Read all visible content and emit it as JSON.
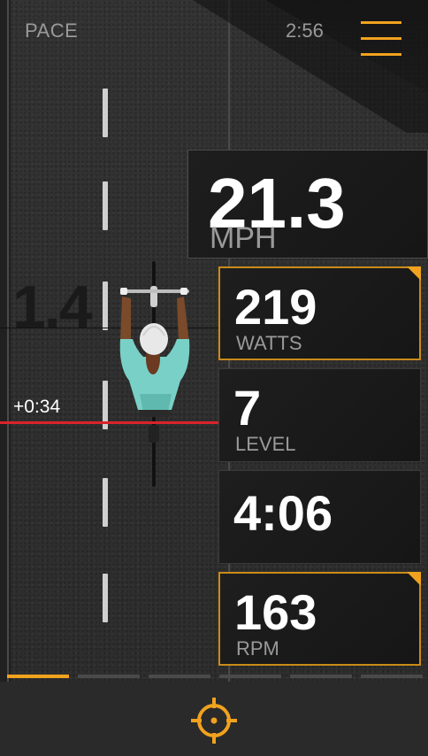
{
  "header": {
    "mode": "PACE",
    "time": "2:56",
    "menu_icon": "hamburger-menu-icon"
  },
  "ride": {
    "ghost_distance": "1.4",
    "gap": "+0:34"
  },
  "metrics": {
    "speed": {
      "value": "21.3",
      "unit": "MPH"
    },
    "watts": {
      "value": "219",
      "unit": "WATTS"
    },
    "level": {
      "value": "7",
      "unit": "LEVEL"
    },
    "elapsed": {
      "value": "4:06",
      "unit": ""
    },
    "rpm": {
      "value": "163",
      "unit": "RPM"
    }
  },
  "pager": {
    "pages": 6,
    "active_index": 0
  },
  "footer": {
    "target_icon": "crosshair-target-icon"
  },
  "colors": {
    "accent": "#f0a21e",
    "gap_line": "#d9232a",
    "tile_bg": "#1a1a1a",
    "road": "#2f2f2f"
  }
}
